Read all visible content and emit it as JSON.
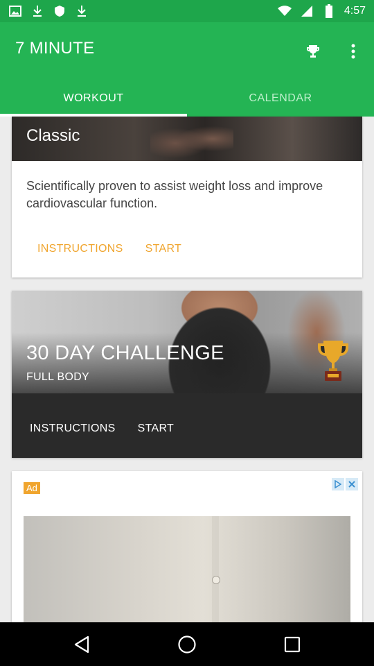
{
  "status_bar": {
    "time": "4:57",
    "icons": [
      "photo-icon",
      "download-icon",
      "shield-icon",
      "download-icon",
      "wifi-icon",
      "signal-icon",
      "battery-icon"
    ]
  },
  "app_bar": {
    "title": "7 MINUTE",
    "icons": [
      "trophy-store-icon",
      "overflow-menu-icon"
    ],
    "background": "#24b454"
  },
  "tabs": [
    {
      "label": "WORKOUT",
      "active": true
    },
    {
      "label": "CALENDAR",
      "active": false
    }
  ],
  "cards": [
    {
      "name": "Classic",
      "description": "Scientifically proven to assist weight loss and improve cardiovascular function.",
      "actions": [
        "INSTRUCTIONS",
        "START"
      ],
      "action_color": "#f0a52e"
    },
    {
      "name": "30 DAY CHALLENGE",
      "subtitle": "FULL BODY",
      "icon": "trophy-icon",
      "actions": [
        "INSTRUCTIONS",
        "START"
      ]
    }
  ],
  "ad": {
    "badge": "Ad",
    "icons": [
      "adchoices-icon",
      "close-icon"
    ]
  },
  "nav_bar": {
    "icons": [
      "back-icon",
      "home-icon",
      "recents-icon"
    ]
  }
}
